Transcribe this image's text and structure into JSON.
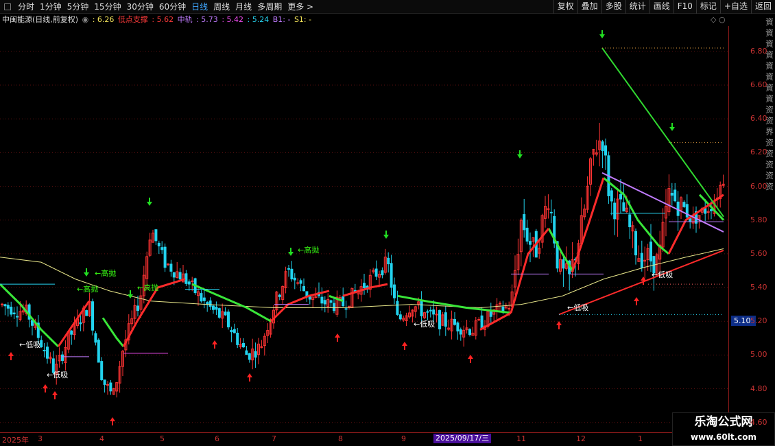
{
  "toolbar": {
    "periods": [
      "分时",
      "1分钟",
      "5分钟",
      "15分钟",
      "30分钟",
      "60分钟",
      "日线",
      "周线",
      "月线",
      "多周期",
      "更多 >"
    ],
    "active_period": "日线",
    "right_buttons": [
      "复权",
      "叠加",
      "多股",
      "统计",
      "画线",
      "F10",
      "标记",
      "+自选",
      "返回"
    ]
  },
  "legend": {
    "title": "中闽能源(日线,前复权)",
    "item1": ": 6.26",
    "item2_label": "低点支撑",
    "item2_value": ": 5.62",
    "item3_label": "中轨",
    "item3_values": ": 5.73",
    "item3_b": ": 5.42",
    "item3_c": ": 5.24",
    "item4": "B1: -",
    "item5": "S1: -"
  },
  "chart_data": {
    "type": "candlestick",
    "ylim": [
      4.55,
      6.95
    ],
    "yticks": [
      4.6,
      4.8,
      5.0,
      5.2,
      5.4,
      5.6,
      5.8,
      6.0,
      6.2,
      6.4,
      6.6,
      6.8
    ],
    "ytick_labels": [
      "4.60",
      "4.80",
      "5.00",
      "5.20",
      "5.40",
      "5.60",
      "5.80",
      "6.00",
      "6.20",
      "6.40",
      "6.60",
      "6.80"
    ],
    "x_labels": [
      "2025年",
      "3",
      "4",
      "5",
      "6",
      "7",
      "8",
      "9",
      "11",
      "12",
      "1"
    ],
    "current_date": "2025/09/17/三",
    "current_price": "5.10",
    "annotations": [
      {
        "text": "低吸",
        "color": "#ffffff"
      },
      {
        "text": "低吸",
        "color": "#ffffff"
      },
      {
        "text": "高抛",
        "color": "#39ff14"
      },
      {
        "text": "高抛",
        "color": "#39ff14"
      },
      {
        "text": "高抛",
        "color": "#39ff14"
      },
      {
        "text": "高抛",
        "color": "#39ff14"
      },
      {
        "text": "低吸",
        "color": "#ffffff"
      },
      {
        "text": "低吸",
        "color": "#ffffff"
      },
      {
        "text": "低吸",
        "color": "#ffffff"
      }
    ],
    "colors": {
      "up": "#ff3333",
      "down": "#22d3ee",
      "ma_yellow": "#e8e68a",
      "trend_green": "#39e639",
      "trend_red": "#ff2b2b",
      "purple": "#c07cff"
    }
  },
  "watermark": {
    "line1": "乐淘公式网",
    "line2": "www.60lt.com"
  },
  "side_chars": "資資資資資資資資资资界资资资资资"
}
